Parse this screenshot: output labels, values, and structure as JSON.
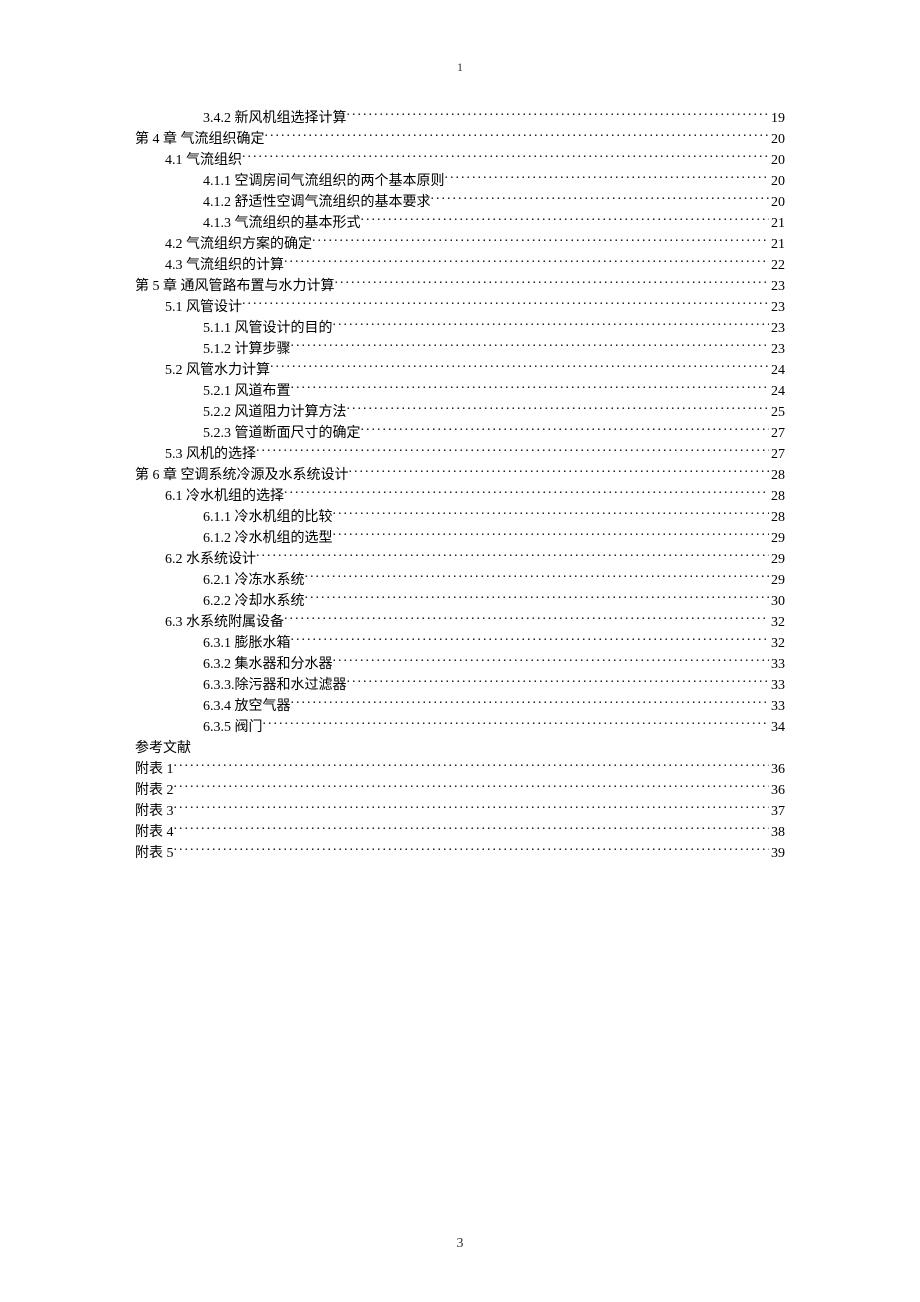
{
  "page_number_top": "1",
  "page_number_bottom": "3",
  "toc": [
    {
      "indent": 2,
      "label": "3.4.2 新风机组选择计算",
      "page": "19"
    },
    {
      "indent": 0,
      "label": "第 4 章  气流组织确定",
      "page": "20"
    },
    {
      "indent": 1,
      "label": "4.1 气流组织",
      "page": "20"
    },
    {
      "indent": 2,
      "label": "4.1.1 空调房间气流组织的两个基本原则",
      "page": "20"
    },
    {
      "indent": 2,
      "label": "4.1.2 舒适性空调气流组织的基本要求",
      "page": "20"
    },
    {
      "indent": 2,
      "label": "4.1.3 气流组织的基本形式",
      "page": "21"
    },
    {
      "indent": 1,
      "label": "4.2 气流组织方案的确定",
      "page": "21"
    },
    {
      "indent": 1,
      "label": "4.3 气流组织的计算",
      "page": "22"
    },
    {
      "indent": 0,
      "label": "第 5 章  通风管路布置与水力计算",
      "page": "23"
    },
    {
      "indent": 1,
      "label": "5.1 风管设计",
      "page": "23"
    },
    {
      "indent": 2,
      "label": "5.1.1 风管设计的目的",
      "page": "23"
    },
    {
      "indent": 2,
      "label": "5.1.2 计算步骤",
      "page": "23"
    },
    {
      "indent": 1,
      "label": "5.2 风管水力计算",
      "page": "24"
    },
    {
      "indent": 2,
      "label": "5.2.1 风道布置",
      "page": "24"
    },
    {
      "indent": 2,
      "label": "5.2.2 风道阻力计算方法",
      "page": "25"
    },
    {
      "indent": 2,
      "label": "5.2.3 管道断面尺寸的确定",
      "page": "27"
    },
    {
      "indent": 1,
      "label": "5.3 风机的选择",
      "page": "27"
    },
    {
      "indent": 0,
      "label": "第 6 章  空调系统冷源及水系统设计",
      "page": "28"
    },
    {
      "indent": 1,
      "label": "6.1 冷水机组的选择",
      "page": "28"
    },
    {
      "indent": 2,
      "label": "6.1.1 冷水机组的比较",
      "page": "28"
    },
    {
      "indent": 2,
      "label": "6.1.2 冷水机组的选型",
      "page": "29"
    },
    {
      "indent": 1,
      "label": "6.2 水系统设计",
      "page": "29"
    },
    {
      "indent": 2,
      "label": "6.2.1 冷冻水系统",
      "page": "29"
    },
    {
      "indent": 2,
      "label": "6.2.2 冷却水系统",
      "page": "30"
    },
    {
      "indent": 1,
      "label": "6.3 水系统附属设备",
      "page": "32"
    },
    {
      "indent": 2,
      "label": "6.3.1 膨胀水箱",
      "page": "32"
    },
    {
      "indent": 2,
      "label": "6.3.2 集水器和分水器",
      "page": "33"
    },
    {
      "indent": 2,
      "label": "6.3.3.除污器和水过滤器",
      "page": "33"
    },
    {
      "indent": 2,
      "label": "6.3.4 放空气器",
      "page": "33"
    },
    {
      "indent": 2,
      "label": "6.3.5 阀门",
      "page": "34"
    },
    {
      "indent": 0,
      "label": "参考文献",
      "page": "",
      "nodots": true
    },
    {
      "indent": 0,
      "label": "附表 1   ",
      "page": "36"
    },
    {
      "indent": 0,
      "label": "附表 2   ",
      "page": "36"
    },
    {
      "indent": 0,
      "label": "附表 3   ",
      "page": "37"
    },
    {
      "indent": 0,
      "label": "附表 4  ",
      "page": "38"
    },
    {
      "indent": 0,
      "label": "附表 5   ",
      "page": "39"
    }
  ]
}
